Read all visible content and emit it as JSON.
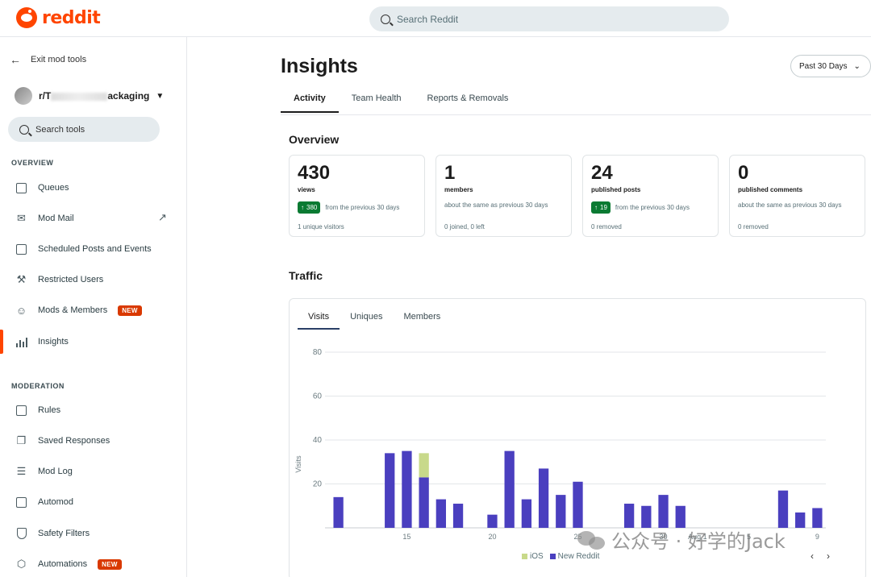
{
  "header": {
    "logo_text": "reddit",
    "search_placeholder": "Search Reddit"
  },
  "sidebar": {
    "exit_label": "Exit mod tools",
    "subreddit_prefix": "r/T",
    "subreddit_suffix": "ackaging",
    "search_tools_label": "Search tools",
    "overview_heading": "OVERVIEW",
    "moderation_heading": "MODERATION",
    "new_badge": "NEW",
    "items": [
      {
        "label": "Queues"
      },
      {
        "label": "Mod Mail"
      },
      {
        "label": "Scheduled Posts and Events"
      },
      {
        "label": "Restricted Users"
      },
      {
        "label": "Mods & Members"
      },
      {
        "label": "Insights"
      },
      {
        "label": "Rules"
      },
      {
        "label": "Saved Responses"
      },
      {
        "label": "Mod Log"
      },
      {
        "label": "Automod"
      },
      {
        "label": "Safety Filters"
      },
      {
        "label": "Automations"
      }
    ]
  },
  "main": {
    "title": "Insights",
    "period": "Past 30 Days",
    "tabs": [
      {
        "label": "Activity"
      },
      {
        "label": "Team Health"
      },
      {
        "label": "Reports & Removals"
      }
    ],
    "overview_heading": "Overview",
    "traffic_heading": "Traffic",
    "cards": [
      {
        "value": "430",
        "label": "views",
        "chip": "380",
        "delta_text": "from the previous 30 days",
        "foot": "1 unique visitors"
      },
      {
        "value": "1",
        "label": "members",
        "chip": "",
        "delta_text": "about the same as previous 30 days",
        "foot": "0 joined, 0 left"
      },
      {
        "value": "24",
        "label": "published posts",
        "chip": "19",
        "delta_text": "from the previous 30 days",
        "foot": "0 removed"
      },
      {
        "value": "0",
        "label": "published comments",
        "chip": "",
        "delta_text": "about the same as previous 30 days",
        "foot": "0 removed"
      }
    ],
    "traffic_tabs": [
      {
        "label": "Visits"
      },
      {
        "label": "Uniques"
      },
      {
        "label": "Members"
      }
    ]
  },
  "colors": {
    "brand": "#ff4500",
    "new_reddit": "#4a3fbf",
    "ios": "#c8d98a",
    "positive": "#0a7a32"
  },
  "watermark": "公众号 · 好学的Jack",
  "chart_data": {
    "type": "bar",
    "stacked": true,
    "ylabel": "Visits",
    "ylim": [
      0,
      80
    ],
    "yticks": [
      20,
      40,
      60,
      80
    ],
    "x_tick_labels": [
      {
        "day": 5,
        "label": "15"
      },
      {
        "day": 10,
        "label": "20"
      },
      {
        "day": 15,
        "label": "25"
      },
      {
        "day": 20,
        "label": "30"
      },
      {
        "day": 22,
        "label": "Aug 1"
      },
      {
        "day": 25,
        "label": "5"
      },
      {
        "day": 29,
        "label": "9"
      }
    ],
    "days": [
      1,
      2,
      3,
      4,
      5,
      6,
      7,
      8,
      9,
      10,
      11,
      12,
      13,
      14,
      15,
      16,
      17,
      18,
      19,
      20,
      21,
      22,
      23,
      24,
      25,
      26,
      27,
      28,
      29
    ],
    "series": [
      {
        "name": "New Reddit",
        "values": [
          14,
          0,
          0,
          34,
          35,
          23,
          13,
          11,
          0,
          6,
          35,
          13,
          27,
          15,
          21,
          0,
          0,
          11,
          10,
          15,
          10,
          0,
          0,
          0,
          0,
          0,
          17,
          7,
          9
        ]
      },
      {
        "name": "iOS",
        "values": [
          0,
          0,
          0,
          0,
          0,
          11,
          0,
          0,
          0,
          0,
          0,
          0,
          0,
          0,
          0,
          0,
          0,
          0,
          0,
          0,
          0,
          0,
          0,
          0,
          0,
          0,
          0,
          0,
          0
        ]
      }
    ],
    "grid": true,
    "legend": "bottom-center"
  }
}
